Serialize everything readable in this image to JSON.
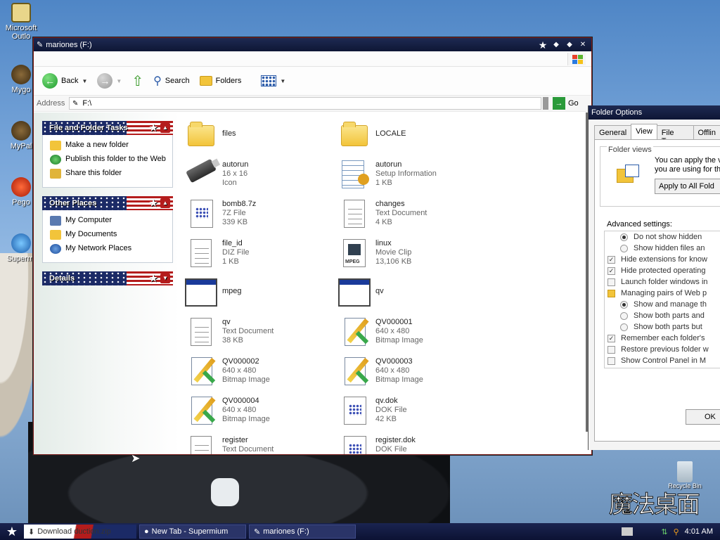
{
  "desktop": {
    "icons": [
      {
        "label": "Microsoft Outlo",
        "icon": "outlook-icon"
      },
      {
        "label": "Mygo",
        "icon": "mygo-icon"
      },
      {
        "label": "MyPal",
        "icon": "mypal-icon"
      },
      {
        "label": "Pego",
        "icon": "pego-icon"
      },
      {
        "label": "Supermi",
        "icon": "supermium-icon"
      }
    ],
    "recycle_label": "Recycle Bin",
    "logo_text": "魔法桌面"
  },
  "explorer": {
    "title": "mariones (F:)",
    "toolbar": {
      "back_label": "Back",
      "search_label": "Search",
      "folders_label": "Folders"
    },
    "address": {
      "label": "Address",
      "value": "F:\\",
      "go_label": "Go"
    },
    "tasks_panel": {
      "title": "File and Folder Tasks",
      "items": [
        {
          "label": "Make a new folder",
          "icon": "new-folder-icon"
        },
        {
          "label": "Publish this folder to the Web",
          "icon": "publish-web-icon"
        },
        {
          "label": "Share this folder",
          "icon": "share-folder-icon"
        }
      ]
    },
    "places_panel": {
      "title": "Other Places",
      "items": [
        {
          "label": "My Computer",
          "icon": "my-computer-icon"
        },
        {
          "label": "My Documents",
          "icon": "my-documents-icon"
        },
        {
          "label": "My Network Places",
          "icon": "network-places-icon"
        }
      ]
    },
    "details_panel": {
      "title": "Details"
    },
    "files": [
      {
        "name": "files",
        "type": "",
        "size": "",
        "icon": "folder"
      },
      {
        "name": "LOCALE",
        "type": "",
        "size": "",
        "icon": "folder"
      },
      {
        "name": "autorun",
        "type": "16 x 16",
        "size": "Icon",
        "icon": "usb"
      },
      {
        "name": "autorun",
        "type": "Setup Information",
        "size": "1 KB",
        "icon": "inf"
      },
      {
        "name": "bomb8.7z",
        "type": "7Z File",
        "size": "339 KB",
        "icon": "grid"
      },
      {
        "name": "changes",
        "type": "Text Document",
        "size": "4 KB",
        "icon": "doc"
      },
      {
        "name": "file_id",
        "type": "DIZ File",
        "size": "1 KB",
        "icon": "doc"
      },
      {
        "name": "linux",
        "type": "Movie Clip",
        "size": "13,106 KB",
        "icon": "mpeg"
      },
      {
        "name": "mpeg",
        "type": "",
        "size": "",
        "icon": "app"
      },
      {
        "name": "qv",
        "type": "",
        "size": "",
        "icon": "app"
      },
      {
        "name": "qv",
        "type": "Text Document",
        "size": "38 KB",
        "icon": "doc"
      },
      {
        "name": "QV000001",
        "type": "640 x 480",
        "size": "Bitmap Image",
        "icon": "bmp"
      },
      {
        "name": "QV000002",
        "type": "640 x 480",
        "size": "Bitmap Image",
        "icon": "bmp"
      },
      {
        "name": "QV000003",
        "type": "640 x 480",
        "size": "Bitmap Image",
        "icon": "bmp"
      },
      {
        "name": "QV000004",
        "type": "640 x 480",
        "size": "Bitmap Image",
        "icon": "bmp"
      },
      {
        "name": "qv.dok",
        "type": "DOK File",
        "size": "42 KB",
        "icon": "grid"
      },
      {
        "name": "register",
        "type": "Text Document",
        "size": "",
        "icon": "doc"
      },
      {
        "name": "register.dok",
        "type": "DOK File",
        "size": "",
        "icon": "grid"
      }
    ]
  },
  "folder_options": {
    "title": "Folder Options",
    "tabs": [
      "General",
      "View",
      "File Types",
      "Offlin"
    ],
    "active_tab": "View",
    "folder_views_label": "Folder views",
    "folder_views_text": [
      "You can apply the v",
      "you are using for thi"
    ],
    "apply_all_label": "Apply to All Fold",
    "advanced_label": "Advanced settings:",
    "settings": [
      {
        "label": "Do not show hidden",
        "control": "radio",
        "checked": true,
        "indent": 2
      },
      {
        "label": "Show hidden files an",
        "control": "radio",
        "checked": false,
        "indent": 2
      },
      {
        "label": "Hide extensions for know",
        "control": "check",
        "checked": true,
        "indent": 1
      },
      {
        "label": "Hide protected operating",
        "control": "check",
        "checked": true,
        "indent": 1
      },
      {
        "label": "Launch folder windows in",
        "control": "check",
        "checked": false,
        "indent": 1
      },
      {
        "label": "Managing pairs of Web p",
        "control": "folder",
        "checked": false,
        "indent": 1
      },
      {
        "label": "Show and manage th",
        "control": "radio",
        "checked": true,
        "indent": 2
      },
      {
        "label": "Show both parts and",
        "control": "radio",
        "checked": false,
        "indent": 2
      },
      {
        "label": "Show both parts but",
        "control": "radio",
        "checked": false,
        "indent": 2
      },
      {
        "label": "Remember each folder's",
        "control": "check",
        "checked": true,
        "indent": 1
      },
      {
        "label": "Restore previous folder w",
        "control": "check",
        "checked": false,
        "indent": 1
      },
      {
        "label": "Show Control Panel in M",
        "control": "check",
        "checked": false,
        "indent": 1
      }
    ],
    "ok_label": "OK"
  },
  "taskbar": {
    "buttons": [
      {
        "label": "Download duction.zip",
        "icon": "download-icon"
      },
      {
        "label": "New Tab - Supermium",
        "icon": "browser-icon"
      },
      {
        "label": "mariones (F:)",
        "icon": "explorer-icon"
      }
    ],
    "clock": "4:01 AM"
  }
}
